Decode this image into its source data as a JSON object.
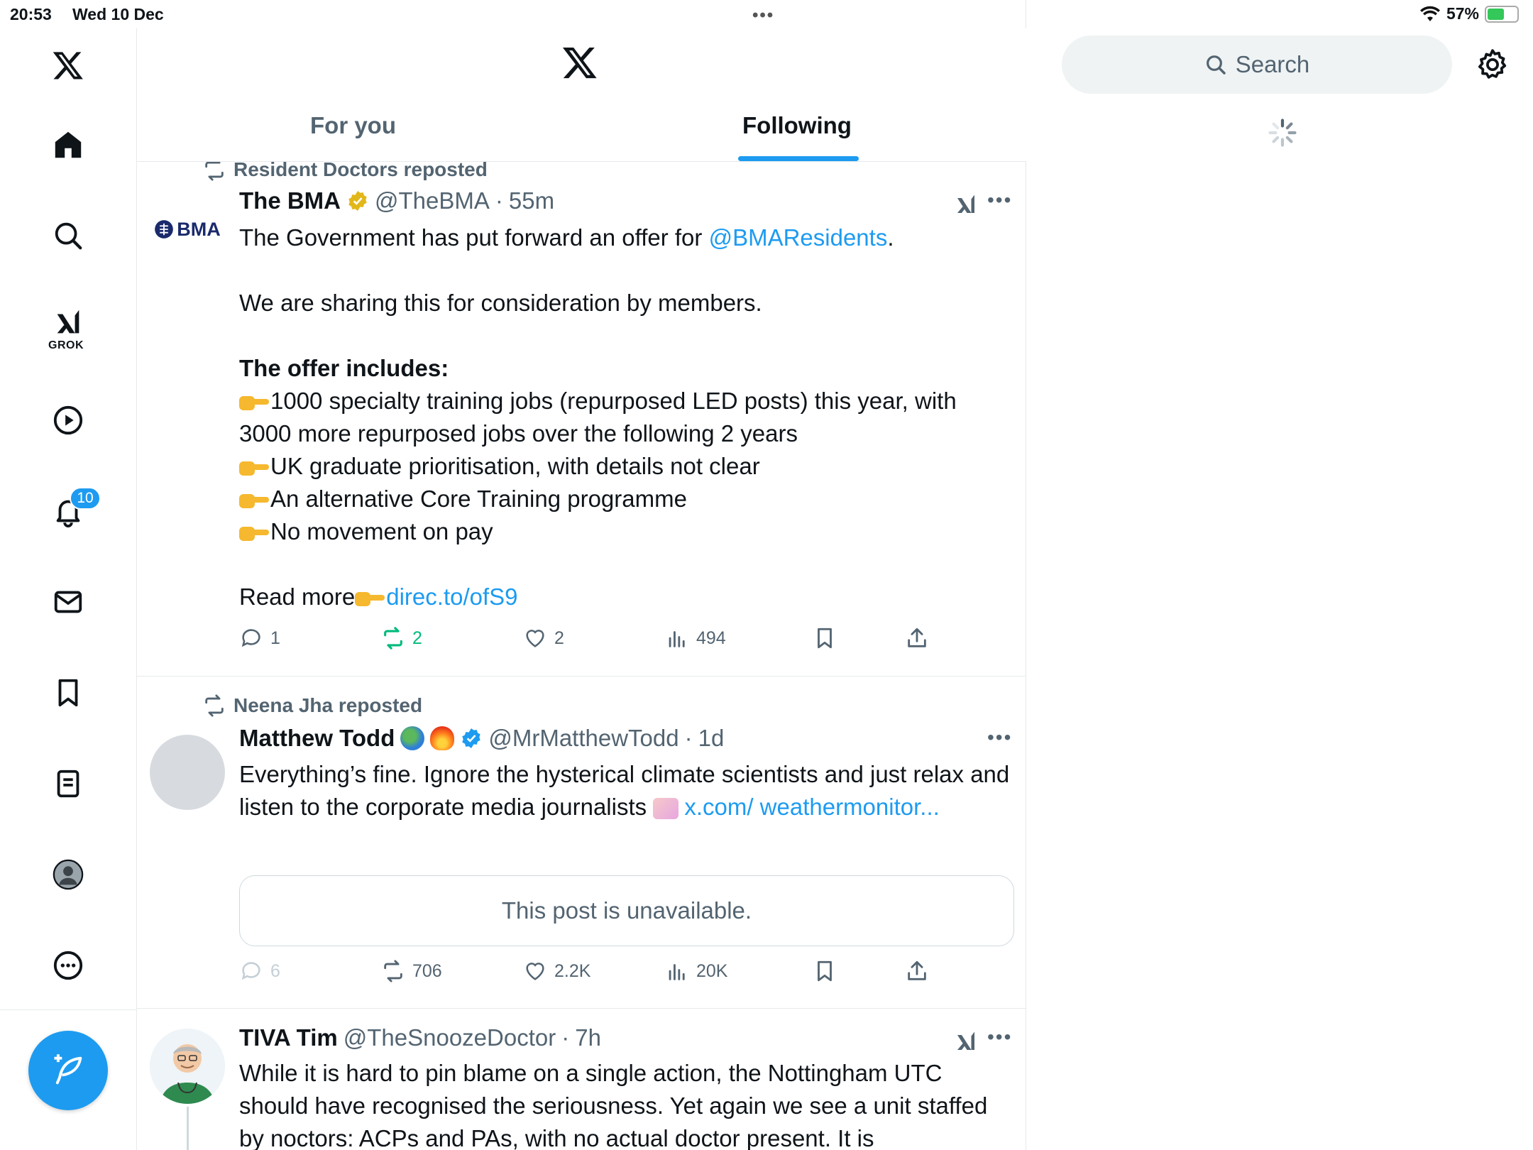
{
  "status_bar": {
    "time": "20:53",
    "date": "Wed 10 Dec",
    "battery": "57%",
    "battery_level": 0.57
  },
  "nav": {
    "items": [
      "home",
      "explore",
      "grok",
      "videos",
      "notifications",
      "messages",
      "bookmarks",
      "lists",
      "profile",
      "more"
    ],
    "grok_label": "GROK",
    "notifications_badge": "10"
  },
  "header": {
    "tabs": [
      {
        "label": "For you"
      },
      {
        "label": "Following"
      }
    ],
    "active_tab": "Following"
  },
  "posts": [
    {
      "repost_by": "Resident Doctors reposted",
      "avatar_text": "BMA",
      "name": "The BMA",
      "handle": "@TheBMA",
      "sep": "·",
      "time": "55m",
      "body": {
        "line1_pre": "The Government has put forward an offer for ",
        "line1_link": "@BMAResidents",
        "line1_post": ".",
        "line2": "We are sharing this for consideration by members.",
        "heading": "The offer includes:",
        "bullet1": "1000 specialty training jobs (repurposed LED posts) this year, with 3000 more repurposed jobs over the following 2 years",
        "bullet2": "UK graduate prioritisation, with details not clear",
        "bullet3": "An alternative Core Training programme",
        "bullet4": "No movement on pay",
        "readmore": "Read more",
        "readmore_link": "direc.to/ofS9"
      },
      "stats": {
        "replies": "1",
        "reposts": "2",
        "likes": "2",
        "views": "494"
      }
    },
    {
      "repost_by": "Neena Jha reposted",
      "name": "Matthew Todd",
      "handle": "@MrMatthewTodd",
      "sep": "·",
      "time": "1d",
      "body": {
        "text": "Everything’s fine. Ignore the hysterical climate scientists and just relax and listen to the corporate media journalists ",
        "link": "x.com/ weathermonitor..."
      },
      "unavailable": "This post is unavailable.",
      "stats": {
        "replies": "6",
        "reposts": "706",
        "likes": "2.2K",
        "views": "20K"
      }
    },
    {
      "name": "TIVA Tim",
      "handle": "@TheSnoozeDoctor",
      "sep": "·",
      "time": "7h",
      "body": {
        "text": "While it is hard to pin blame on a single action, the Nottingham UTC should have recognised the seriousness. Yet again we see a unit staffed by noctors: ACPs and PAs, with no actual doctor present. It is"
      }
    }
  ],
  "right": {
    "search_placeholder": "Search"
  },
  "colors": {
    "accent": "#1d9bf0",
    "repost_green": "#00ba7c",
    "text_secondary": "#536471",
    "verified_gold": "#e2b719"
  }
}
